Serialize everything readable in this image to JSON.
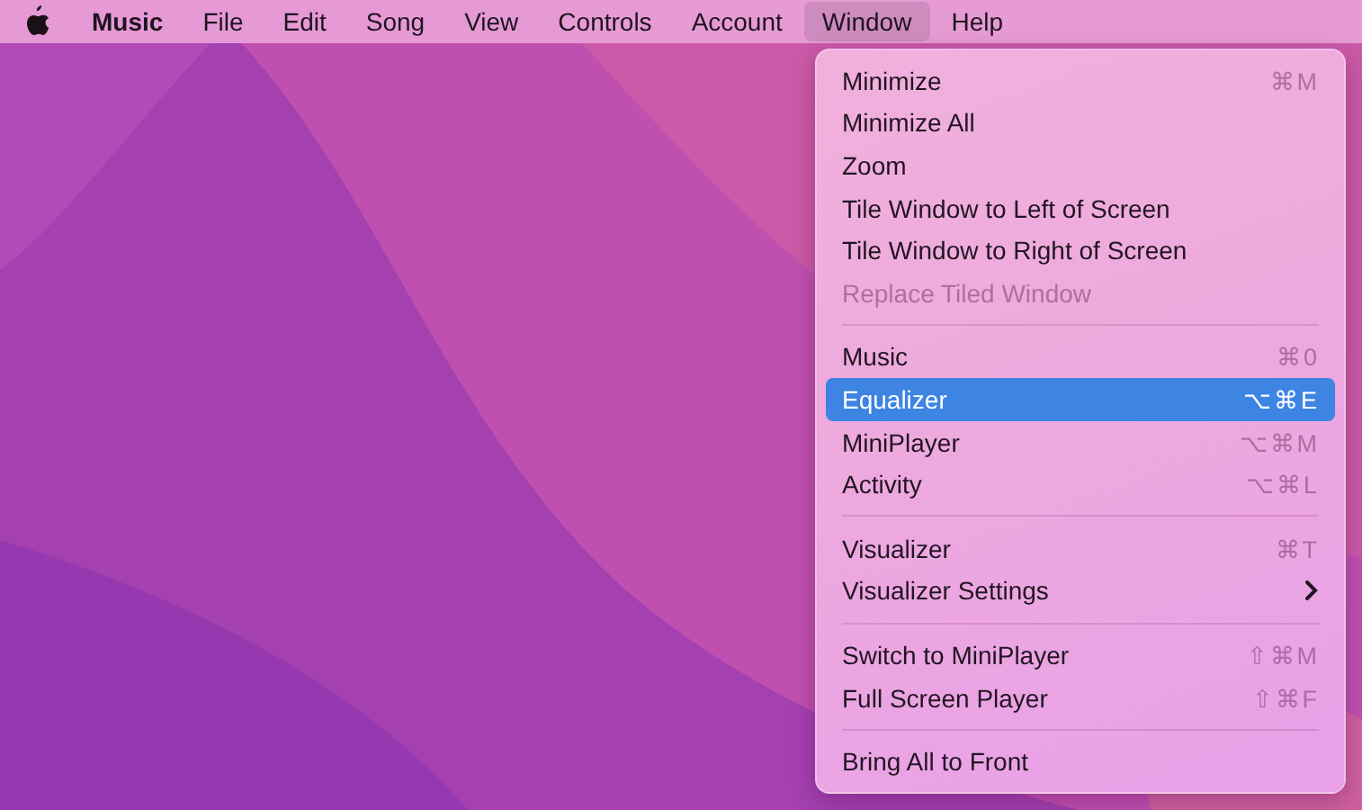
{
  "menu_bar": {
    "app_name": "Music",
    "menus": [
      {
        "label": "File",
        "selected": false
      },
      {
        "label": "Edit",
        "selected": false
      },
      {
        "label": "Song",
        "selected": false
      },
      {
        "label": "View",
        "selected": false
      },
      {
        "label": "Controls",
        "selected": false
      },
      {
        "label": "Account",
        "selected": false
      },
      {
        "label": "Window",
        "selected": true
      },
      {
        "label": "Help",
        "selected": false
      }
    ]
  },
  "window_menu": {
    "groups": [
      [
        {
          "label": "Minimize",
          "shortcut": "⌘M",
          "disabled": false,
          "selected": false,
          "submenu": false
        },
        {
          "label": "Minimize All",
          "disabled": false,
          "selected": false,
          "submenu": false
        },
        {
          "label": "Zoom",
          "disabled": false,
          "selected": false,
          "submenu": false
        },
        {
          "label": "Tile Window to Left of Screen",
          "disabled": false,
          "selected": false,
          "submenu": false
        },
        {
          "label": "Tile Window to Right of Screen",
          "disabled": false,
          "selected": false,
          "submenu": false
        },
        {
          "label": "Replace Tiled Window",
          "disabled": true,
          "selected": false,
          "submenu": false
        }
      ],
      [
        {
          "label": "Music",
          "shortcut": "⌘0",
          "disabled": false,
          "selected": false,
          "submenu": false
        },
        {
          "label": "Equalizer",
          "shortcut": "⌥⌘E",
          "disabled": false,
          "selected": true,
          "submenu": false
        },
        {
          "label": "MiniPlayer",
          "shortcut": "⌥⌘M",
          "disabled": false,
          "selected": false,
          "submenu": false
        },
        {
          "label": "Activity",
          "shortcut": "⌥⌘L",
          "disabled": false,
          "selected": false,
          "submenu": false
        }
      ],
      [
        {
          "label": "Visualizer",
          "shortcut": "⌘T",
          "disabled": false,
          "selected": false,
          "submenu": false
        },
        {
          "label": "Visualizer Settings",
          "disabled": false,
          "selected": false,
          "submenu": true
        }
      ],
      [
        {
          "label": "Switch to MiniPlayer",
          "shortcut": "⇧⌘M",
          "disabled": false,
          "selected": false,
          "submenu": false
        },
        {
          "label": "Full Screen Player",
          "shortcut": "⇧⌘F",
          "disabled": false,
          "selected": false,
          "submenu": false
        }
      ],
      [
        {
          "label": "Bring All to Front",
          "disabled": false,
          "selected": false,
          "submenu": false
        }
      ]
    ]
  }
}
